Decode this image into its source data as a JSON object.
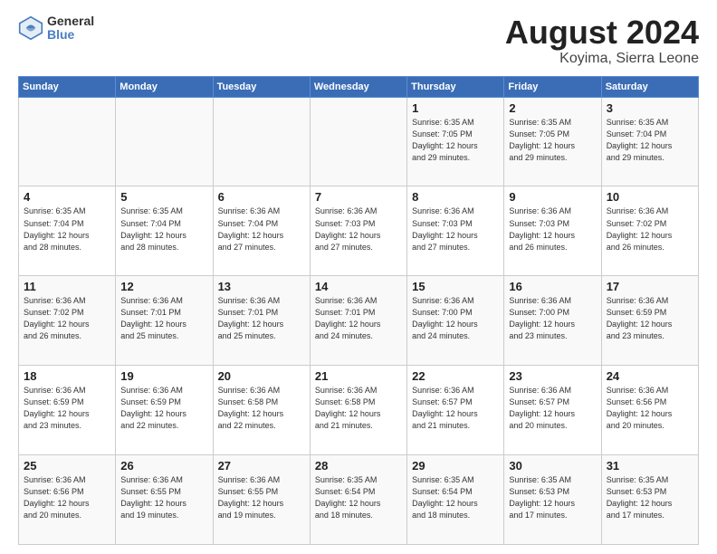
{
  "logo": {
    "general": "General",
    "blue": "Blue"
  },
  "header": {
    "month": "August 2024",
    "location": "Koyima, Sierra Leone"
  },
  "weekdays": [
    "Sunday",
    "Monday",
    "Tuesday",
    "Wednesday",
    "Thursday",
    "Friday",
    "Saturday"
  ],
  "weeks": [
    [
      {
        "day": "",
        "info": ""
      },
      {
        "day": "",
        "info": ""
      },
      {
        "day": "",
        "info": ""
      },
      {
        "day": "",
        "info": ""
      },
      {
        "day": "1",
        "info": "Sunrise: 6:35 AM\nSunset: 7:05 PM\nDaylight: 12 hours\nand 29 minutes."
      },
      {
        "day": "2",
        "info": "Sunrise: 6:35 AM\nSunset: 7:05 PM\nDaylight: 12 hours\nand 29 minutes."
      },
      {
        "day": "3",
        "info": "Sunrise: 6:35 AM\nSunset: 7:04 PM\nDaylight: 12 hours\nand 29 minutes."
      }
    ],
    [
      {
        "day": "4",
        "info": "Sunrise: 6:35 AM\nSunset: 7:04 PM\nDaylight: 12 hours\nand 28 minutes."
      },
      {
        "day": "5",
        "info": "Sunrise: 6:35 AM\nSunset: 7:04 PM\nDaylight: 12 hours\nand 28 minutes."
      },
      {
        "day": "6",
        "info": "Sunrise: 6:36 AM\nSunset: 7:04 PM\nDaylight: 12 hours\nand 27 minutes."
      },
      {
        "day": "7",
        "info": "Sunrise: 6:36 AM\nSunset: 7:03 PM\nDaylight: 12 hours\nand 27 minutes."
      },
      {
        "day": "8",
        "info": "Sunrise: 6:36 AM\nSunset: 7:03 PM\nDaylight: 12 hours\nand 27 minutes."
      },
      {
        "day": "9",
        "info": "Sunrise: 6:36 AM\nSunset: 7:03 PM\nDaylight: 12 hours\nand 26 minutes."
      },
      {
        "day": "10",
        "info": "Sunrise: 6:36 AM\nSunset: 7:02 PM\nDaylight: 12 hours\nand 26 minutes."
      }
    ],
    [
      {
        "day": "11",
        "info": "Sunrise: 6:36 AM\nSunset: 7:02 PM\nDaylight: 12 hours\nand 26 minutes."
      },
      {
        "day": "12",
        "info": "Sunrise: 6:36 AM\nSunset: 7:01 PM\nDaylight: 12 hours\nand 25 minutes."
      },
      {
        "day": "13",
        "info": "Sunrise: 6:36 AM\nSunset: 7:01 PM\nDaylight: 12 hours\nand 25 minutes."
      },
      {
        "day": "14",
        "info": "Sunrise: 6:36 AM\nSunset: 7:01 PM\nDaylight: 12 hours\nand 24 minutes."
      },
      {
        "day": "15",
        "info": "Sunrise: 6:36 AM\nSunset: 7:00 PM\nDaylight: 12 hours\nand 24 minutes."
      },
      {
        "day": "16",
        "info": "Sunrise: 6:36 AM\nSunset: 7:00 PM\nDaylight: 12 hours\nand 23 minutes."
      },
      {
        "day": "17",
        "info": "Sunrise: 6:36 AM\nSunset: 6:59 PM\nDaylight: 12 hours\nand 23 minutes."
      }
    ],
    [
      {
        "day": "18",
        "info": "Sunrise: 6:36 AM\nSunset: 6:59 PM\nDaylight: 12 hours\nand 23 minutes."
      },
      {
        "day": "19",
        "info": "Sunrise: 6:36 AM\nSunset: 6:59 PM\nDaylight: 12 hours\nand 22 minutes."
      },
      {
        "day": "20",
        "info": "Sunrise: 6:36 AM\nSunset: 6:58 PM\nDaylight: 12 hours\nand 22 minutes."
      },
      {
        "day": "21",
        "info": "Sunrise: 6:36 AM\nSunset: 6:58 PM\nDaylight: 12 hours\nand 21 minutes."
      },
      {
        "day": "22",
        "info": "Sunrise: 6:36 AM\nSunset: 6:57 PM\nDaylight: 12 hours\nand 21 minutes."
      },
      {
        "day": "23",
        "info": "Sunrise: 6:36 AM\nSunset: 6:57 PM\nDaylight: 12 hours\nand 20 minutes."
      },
      {
        "day": "24",
        "info": "Sunrise: 6:36 AM\nSunset: 6:56 PM\nDaylight: 12 hours\nand 20 minutes."
      }
    ],
    [
      {
        "day": "25",
        "info": "Sunrise: 6:36 AM\nSunset: 6:56 PM\nDaylight: 12 hours\nand 20 minutes."
      },
      {
        "day": "26",
        "info": "Sunrise: 6:36 AM\nSunset: 6:55 PM\nDaylight: 12 hours\nand 19 minutes."
      },
      {
        "day": "27",
        "info": "Sunrise: 6:36 AM\nSunset: 6:55 PM\nDaylight: 12 hours\nand 19 minutes."
      },
      {
        "day": "28",
        "info": "Sunrise: 6:35 AM\nSunset: 6:54 PM\nDaylight: 12 hours\nand 18 minutes."
      },
      {
        "day": "29",
        "info": "Sunrise: 6:35 AM\nSunset: 6:54 PM\nDaylight: 12 hours\nand 18 minutes."
      },
      {
        "day": "30",
        "info": "Sunrise: 6:35 AM\nSunset: 6:53 PM\nDaylight: 12 hours\nand 17 minutes."
      },
      {
        "day": "31",
        "info": "Sunrise: 6:35 AM\nSunset: 6:53 PM\nDaylight: 12 hours\nand 17 minutes."
      }
    ]
  ]
}
